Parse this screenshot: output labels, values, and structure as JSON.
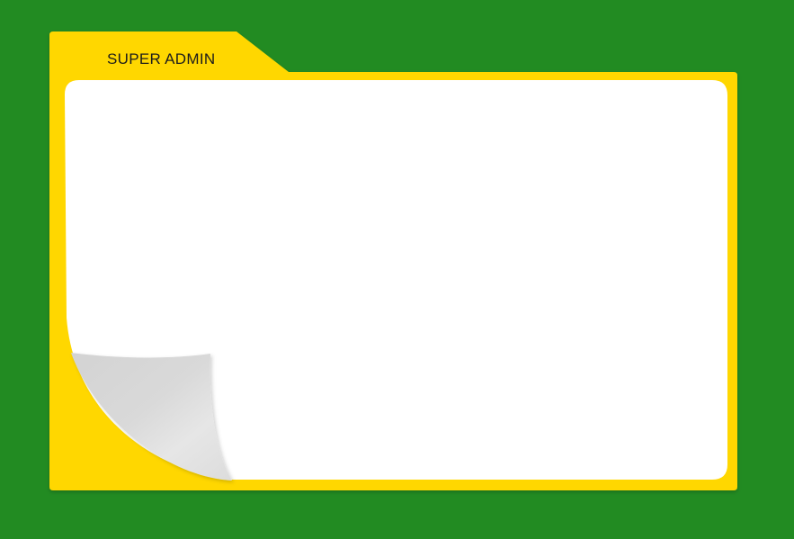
{
  "folder": {
    "tab_label": "SUPER ADMIN"
  },
  "colors": {
    "background": "#228B22",
    "folder": "#FFD700",
    "sheet": "#FFFFFF",
    "curl_light": "#E6E6E6",
    "curl_dark": "#D4D4D4"
  }
}
